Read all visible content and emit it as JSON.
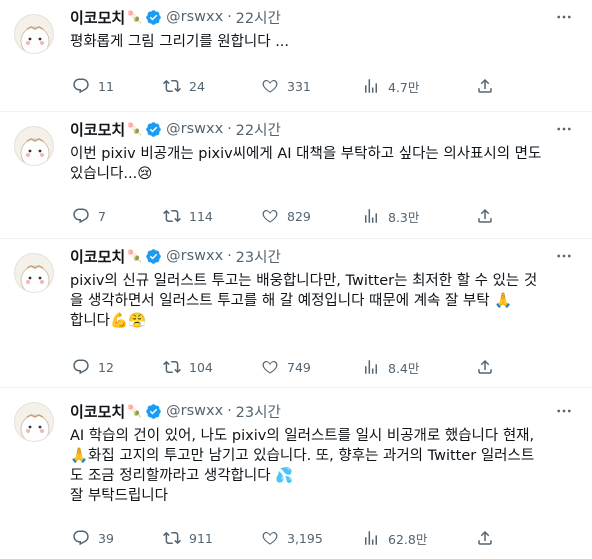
{
  "tweets": [
    {
      "author": "이코모치",
      "handle": "@rswxx",
      "time": "22시간",
      "lines": [
        "평화롭게 그림 그리기를 원합니다 ..."
      ],
      "emoji_tail": "",
      "replies": "11",
      "retweets": "24",
      "likes": "331",
      "views": "4.7만"
    },
    {
      "author": "이코모치",
      "handle": "@rswxx",
      "time": "22시간",
      "lines": [
        "이번 pixiv 비공개는 pixiv씨에게 AI 대책을 부탁하고 싶다는 의사표시의 면도",
        "있습니다..."
      ],
      "emoji_tail": "😢",
      "replies": "7",
      "retweets": "114",
      "likes": "829",
      "views": "8.3만"
    },
    {
      "author": "이코모치",
      "handle": "@rswxx",
      "time": "23시간",
      "lines": [
        "pixiv의 신규 일러스트 투고는 배웅합니다만, Twitter는 최저한 할 수 있는 것",
        "을 생각하면서 일러스트 투고를 해 갈 예정입니다 때문에 계속 잘 부탁 🙏",
        "합니다"
      ],
      "emoji_tail": "💪😤",
      "replies": "12",
      "retweets": "104",
      "likes": "749",
      "views": "8.4만"
    },
    {
      "author": "이코모치",
      "handle": "@rswxx",
      "time": "23시간",
      "lines": [
        "AI 학습의 건이 있어, 나도 pixiv의 일러스트를 일시 비공개로 했습니다 현재,",
        "🙏화집 고지의 투고만 남기고 있습니다. 또, 향후는 과거의 Twitter 일러스트",
        "도 조금 정리할까라고 생각합니다 💦",
        "잘 부탁드립니다"
      ],
      "emoji_tail": "",
      "replies": "39",
      "retweets": "911",
      "likes": "3,195",
      "views": "62.8만"
    }
  ],
  "name_emoji": "🍡",
  "icons": {
    "verified": "verified-badge-icon",
    "more": "more-horizontal-icon",
    "reply": "reply-icon",
    "retweet": "retweet-icon",
    "like": "heart-icon",
    "views": "views-chart-icon",
    "share": "share-icon"
  },
  "colors": {
    "verified": "#1d9bf0",
    "text": "#0f1419",
    "muted": "#536471",
    "divider": "#eff3f4"
  }
}
